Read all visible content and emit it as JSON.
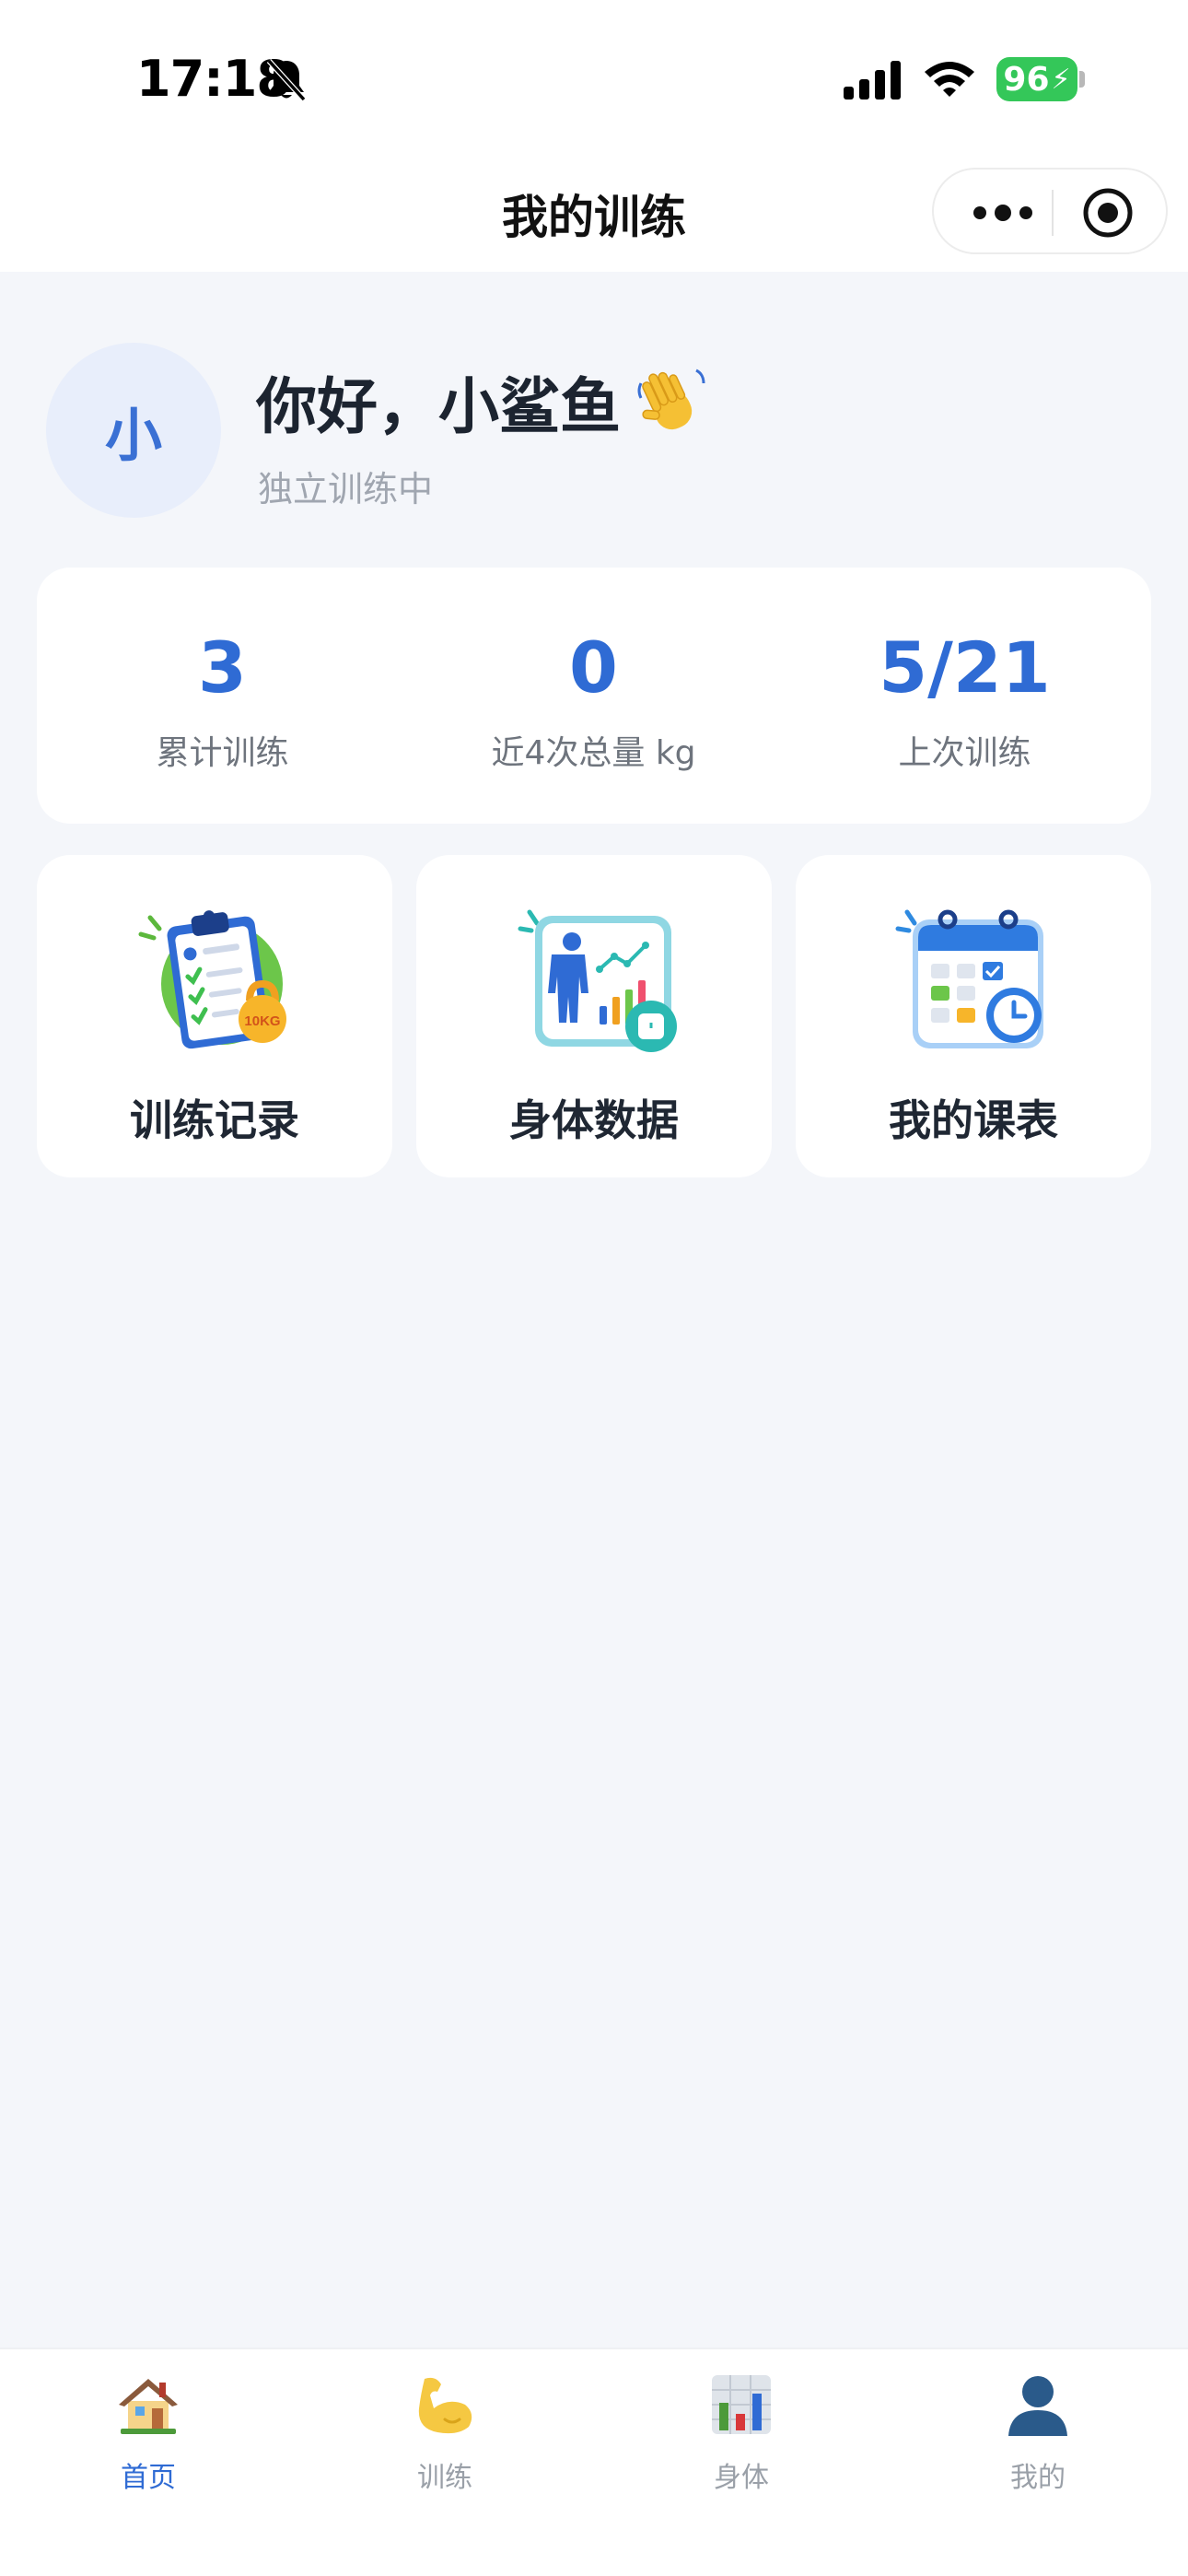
{
  "status_bar": {
    "time": "17:18",
    "battery": "96",
    "icons": [
      "bell-slash-icon",
      "signal-icon",
      "wifi-icon",
      "battery-charging-icon"
    ]
  },
  "nav": {
    "title": "我的训练",
    "capsule_icons": [
      "more-icon",
      "close-target-icon"
    ]
  },
  "profile": {
    "avatar_text": "小",
    "greeting": "你好，小鲨鱼",
    "greeting_icon": "waving-hand-icon",
    "subtitle": "独立训练中"
  },
  "stats": [
    {
      "value": "3",
      "label": "累计训练"
    },
    {
      "value": "0",
      "label": "近4次总量 kg"
    },
    {
      "value": "5/21",
      "label": "上次训练"
    }
  ],
  "features": [
    {
      "label": "训练记录",
      "icon": "clipboard-kettlebell-icon"
    },
    {
      "label": "身体数据",
      "icon": "body-chart-icon"
    },
    {
      "label": "我的课表",
      "icon": "calendar-clock-icon"
    }
  ],
  "tabs": [
    {
      "label": "首页",
      "icon": "house-icon",
      "active": true
    },
    {
      "label": "训练",
      "icon": "flexed-bicep-icon",
      "active": false
    },
    {
      "label": "身体",
      "icon": "bar-chart-icon",
      "active": false
    },
    {
      "label": "我的",
      "icon": "user-silhouette-icon",
      "active": false
    }
  ],
  "colors": {
    "accent": "#2f6bd4",
    "background": "#f4f6fa",
    "battery": "#34c759"
  }
}
